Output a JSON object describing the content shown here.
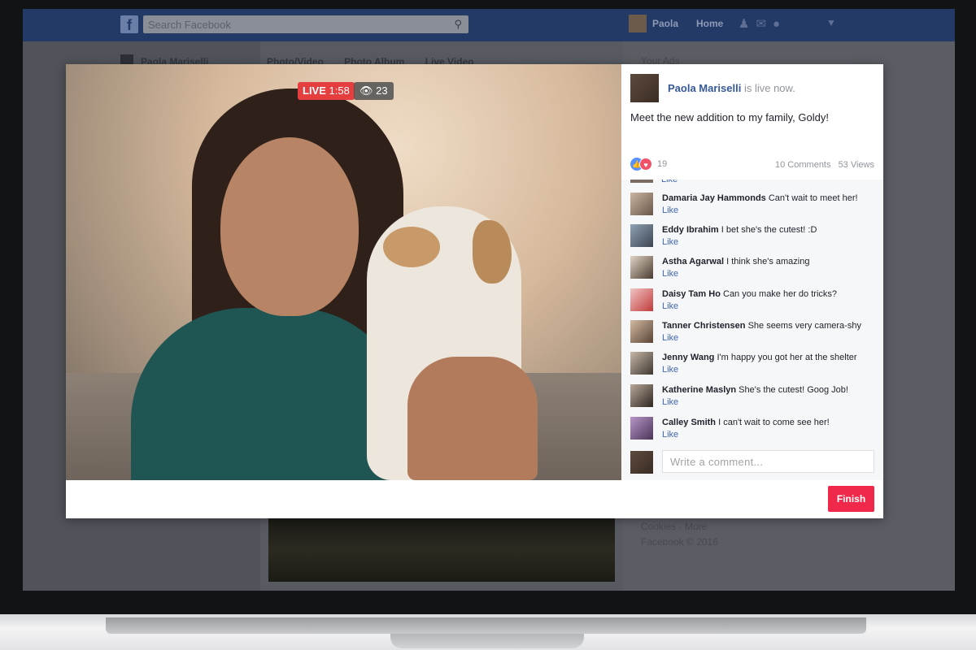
{
  "app": {
    "search_placeholder": "Search Facebook",
    "top_user_name": "Paola",
    "top_home": "Home"
  },
  "background": {
    "left_user_name": "Paola Mariselli",
    "composer_tabs": [
      "Photo/Video",
      "Photo Album",
      "Live Video"
    ],
    "ads_label": "Your Ads",
    "footer_line1": "Cookies · More",
    "footer_line2": "Facebook © 2016"
  },
  "live": {
    "live_label": "LIVE",
    "timer": "1:58",
    "viewers": "23"
  },
  "post": {
    "author": "Paola Mariselli",
    "status": "is live now.",
    "text": "Meet the new addition to my family, Goldy!",
    "reaction_count": "19",
    "comments_count": "10 Comments",
    "views_count": "53 Views"
  },
  "comments": {
    "like_label": "Like",
    "items": [
      {
        "author": "Damaria Jay Hammonds",
        "text": "Can't wait to meet her!"
      },
      {
        "author": "Eddy Ibrahim",
        "text": "I bet she's the cutest! :D"
      },
      {
        "author": "Astha Agarwal",
        "text": "I think she's amazing"
      },
      {
        "author": "Daisy Tam Ho",
        "text": "Can you make her do tricks?"
      },
      {
        "author": "Tanner Christensen",
        "text": "She seems very camera-shy"
      },
      {
        "author": "Jenny Wang",
        "text": "I'm happy you got her at the shelter"
      },
      {
        "author": "Katherine Maslyn",
        "text": "She's the cutest! Goog Job!"
      },
      {
        "author": "Calley Smith",
        "text": "I can't wait to come see her!"
      }
    ],
    "input_placeholder": "Write a comment..."
  },
  "actions": {
    "finish_label": "Finish"
  },
  "colors": {
    "live_red": "#e53e3e",
    "finish_red": "#f02849",
    "link_blue": "#365899",
    "like_blue": "#4267b2"
  }
}
